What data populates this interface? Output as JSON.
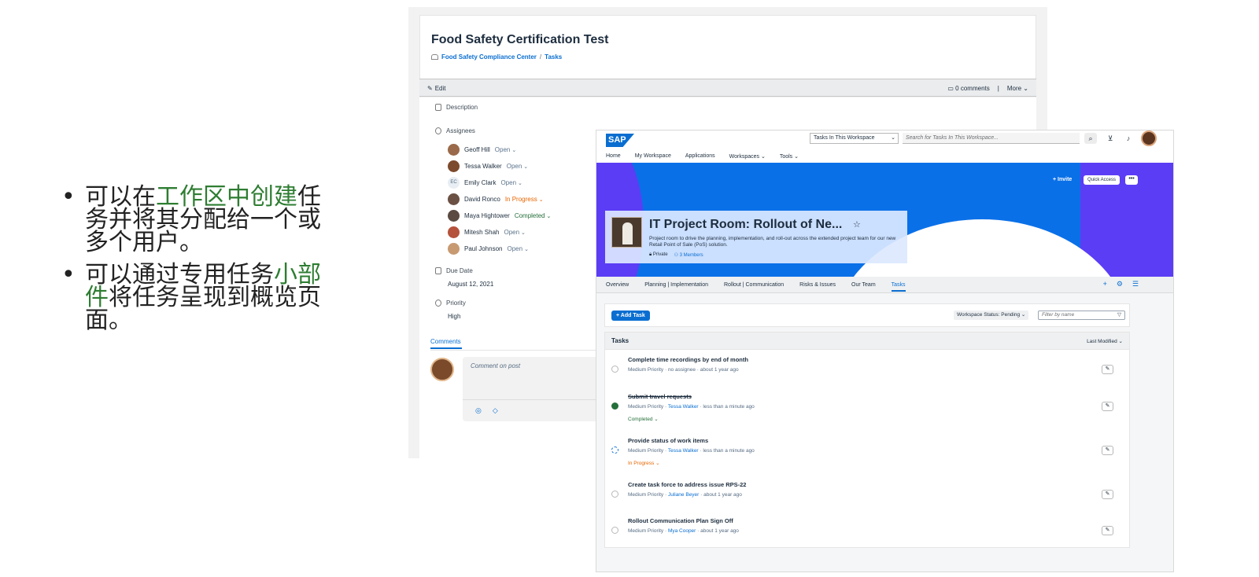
{
  "bullets": [
    {
      "pre": "可以在",
      "hl": "工作区中创建",
      "post": "任务并将其分配给一个或多个用户。"
    },
    {
      "pre": "可以通过专用任务",
      "hl": "小部件",
      "post": "将任务呈现到概览页面。"
    }
  ],
  "task_detail": {
    "title": "Food Safety Certification Test",
    "breadcrumb": [
      "Food Safety Compliance Center",
      "Tasks"
    ],
    "breadcrumb_sep": "/",
    "edit_label": "Edit",
    "comments_count": "0 comments",
    "divider": "|",
    "more_label": "More",
    "description_label": "Description",
    "assignees_label": "Assignees",
    "assignees": [
      {
        "name": "Geoff Hill",
        "status": "Open",
        "kind": "open"
      },
      {
        "name": "Tessa Walker",
        "status": "Open",
        "kind": "open"
      },
      {
        "name": "Emily Clark",
        "status": "Open",
        "kind": "open",
        "initials": "EC"
      },
      {
        "name": "David Ronco",
        "status": "In Progress",
        "kind": "prog"
      },
      {
        "name": "Maya Hightower",
        "status": "Completed",
        "kind": "comp"
      },
      {
        "name": "Mitesh Shah",
        "status": "Open",
        "kind": "open"
      },
      {
        "name": "Paul Johnson",
        "status": "Open",
        "kind": "open"
      }
    ],
    "due_date_label": "Due Date",
    "due_date": "August 12, 2021",
    "priority_label": "Priority",
    "priority": "High",
    "comments_tab": "Comments",
    "comment_placeholder": "Comment on post"
  },
  "workspace": {
    "logo": "SAP",
    "search_scope": "Tasks In This Workspace",
    "search_placeholder": "Search for Tasks In This Workspace...",
    "nav": [
      "Home",
      "My Workspace",
      "Applications",
      "Workspaces",
      "Tools"
    ],
    "invite_label": "Invite",
    "quick_access_label": "Quick Access",
    "more_dots": "•••",
    "room_title": "IT Project Room: Rollout of Ne...",
    "room_desc": "Project room to drive the planning, implementation, and roll-out across the extended project team for our new Retail Point of Sale (PoS) solution.",
    "privacy": "Private",
    "members": "3 Members",
    "tabs": [
      "Overview",
      "Planning | Implementation",
      "Rollout | Communication",
      "Risks & Issues",
      "Our Team",
      "Tasks"
    ],
    "active_tab": "Tasks",
    "add_task_label": "Add Task",
    "workspace_status": "Workspace Status: Pending",
    "filter_placeholder": "Filter by name",
    "tasks_header": "Tasks",
    "sort_label": "Last Modified",
    "tasks": [
      {
        "title": "Complete time recordings by end of month",
        "priority": "Medium Priority",
        "assignee": "no assignee",
        "time": "about 1 year ago",
        "state": "",
        "kind": "open"
      },
      {
        "title": "Submit travel requests",
        "priority": "Medium Priority",
        "assignee": "Tessa Walker",
        "time": "less than a minute ago",
        "state": "Completed",
        "kind": "done"
      },
      {
        "title": "Provide status of work items",
        "priority": "Medium Priority",
        "assignee": "Tessa Walker",
        "time": "less than a minute ago",
        "state": "In Progress",
        "kind": "prog"
      },
      {
        "title": "Create task force to address issue RPS-22",
        "priority": "Medium Priority",
        "assignee": "Juliane Beyer",
        "time": "about 1 year ago",
        "state": "",
        "kind": "open"
      },
      {
        "title": "Rollout Communication Plan Sign Off",
        "priority": "Medium Priority",
        "assignee": "Mya Cooper",
        "time": "about 1 year ago",
        "state": "",
        "kind": "open"
      }
    ]
  },
  "colors": {
    "accent": "#0a6ed1",
    "highlight": "#2e7d32",
    "banner_blue": "#0a70e8",
    "banner_purple": "#5b3df5"
  }
}
